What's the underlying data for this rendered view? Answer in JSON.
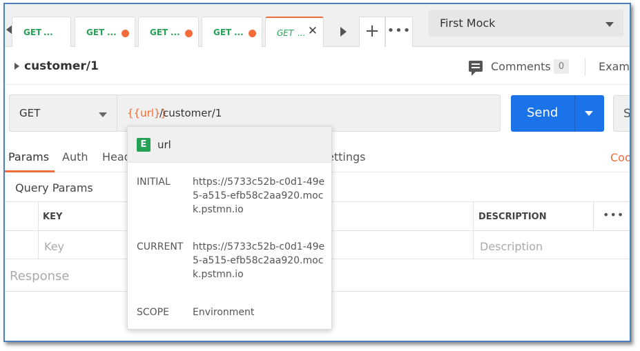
{
  "tabs": [
    {
      "method": "GET",
      "label": "...",
      "unsaved": false
    },
    {
      "method": "GET",
      "label": "...",
      "unsaved": true
    },
    {
      "method": "GET",
      "label": "...",
      "unsaved": true
    },
    {
      "method": "GET",
      "label": "...",
      "unsaved": true
    },
    {
      "method": "GET",
      "label": "...",
      "active": true
    }
  ],
  "tab_actions": {
    "new_tab": "+",
    "more": "•••"
  },
  "environment": {
    "selected": "First Mock"
  },
  "breadcrumb": {
    "title": "customer/1"
  },
  "comments": {
    "label": "Comments",
    "count": "0"
  },
  "examples": {
    "label": "Examp"
  },
  "request": {
    "method": "GET",
    "url_variable": "{{url}}",
    "url_path": "/customer/1",
    "send_label": "Send",
    "save_label": "Sa"
  },
  "request_tabs": {
    "params": "Params",
    "auth": "Auth",
    "headers": "Head",
    "settings": "ettings",
    "cookies": "Coo"
  },
  "query_params": {
    "title": "Query Params",
    "columns": {
      "key": "KEY",
      "description": "DESCRIPTION",
      "more": "•••"
    },
    "placeholders": {
      "key": "Key",
      "description": "Description"
    }
  },
  "response": {
    "label": "Response"
  },
  "variable_tooltip": {
    "scope_badge": "E",
    "name": "url",
    "initial_label": "INITIAL",
    "initial_value": "https://5733c52b-c0d1-49e5-a515-efb58c2aa920.mock.pstmn.io",
    "current_label": "CURRENT",
    "current_value": "https://5733c52b-c0d1-49e5-a515-efb58c2aa920.mock.pstmn.io",
    "scope_label": "SCOPE",
    "scope_value": "Environment"
  },
  "colors": {
    "accent_orange": "#f26b3a",
    "get_green": "#26a156",
    "send_blue": "#1a73e8",
    "frame_border": "#4a7fc0"
  }
}
